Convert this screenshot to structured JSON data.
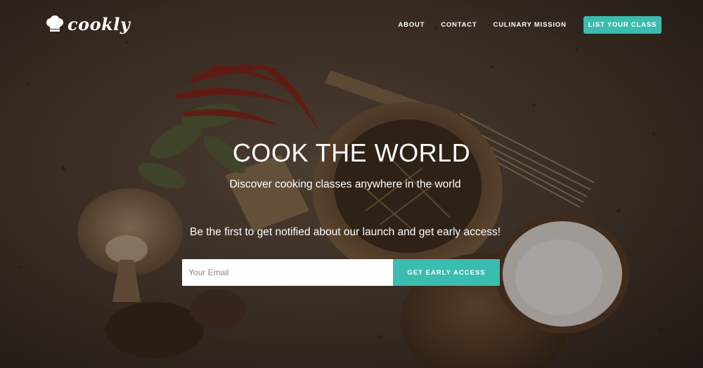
{
  "brand": {
    "logo_text": "cookly",
    "logo_icon": "chef-hat-icon"
  },
  "nav": {
    "items": [
      {
        "label": "ABOUT"
      },
      {
        "label": "CONTACT"
      },
      {
        "label": "CULINARY MISSION"
      }
    ],
    "cta_label": "LIST YOUR CLASS"
  },
  "hero": {
    "headline": "COOK THE WORLD",
    "subheadline": "Discover cooking classes anywhere in the world",
    "notify_text": "Be the first to get notified about our launch and get early access!"
  },
  "signup": {
    "email_placeholder": "Your Email",
    "email_value": "",
    "button_label": "GET EARLY ACCESS"
  },
  "colors": {
    "accent": "#3bbcb0",
    "text": "#ffffff",
    "background": "#3a2f26"
  }
}
